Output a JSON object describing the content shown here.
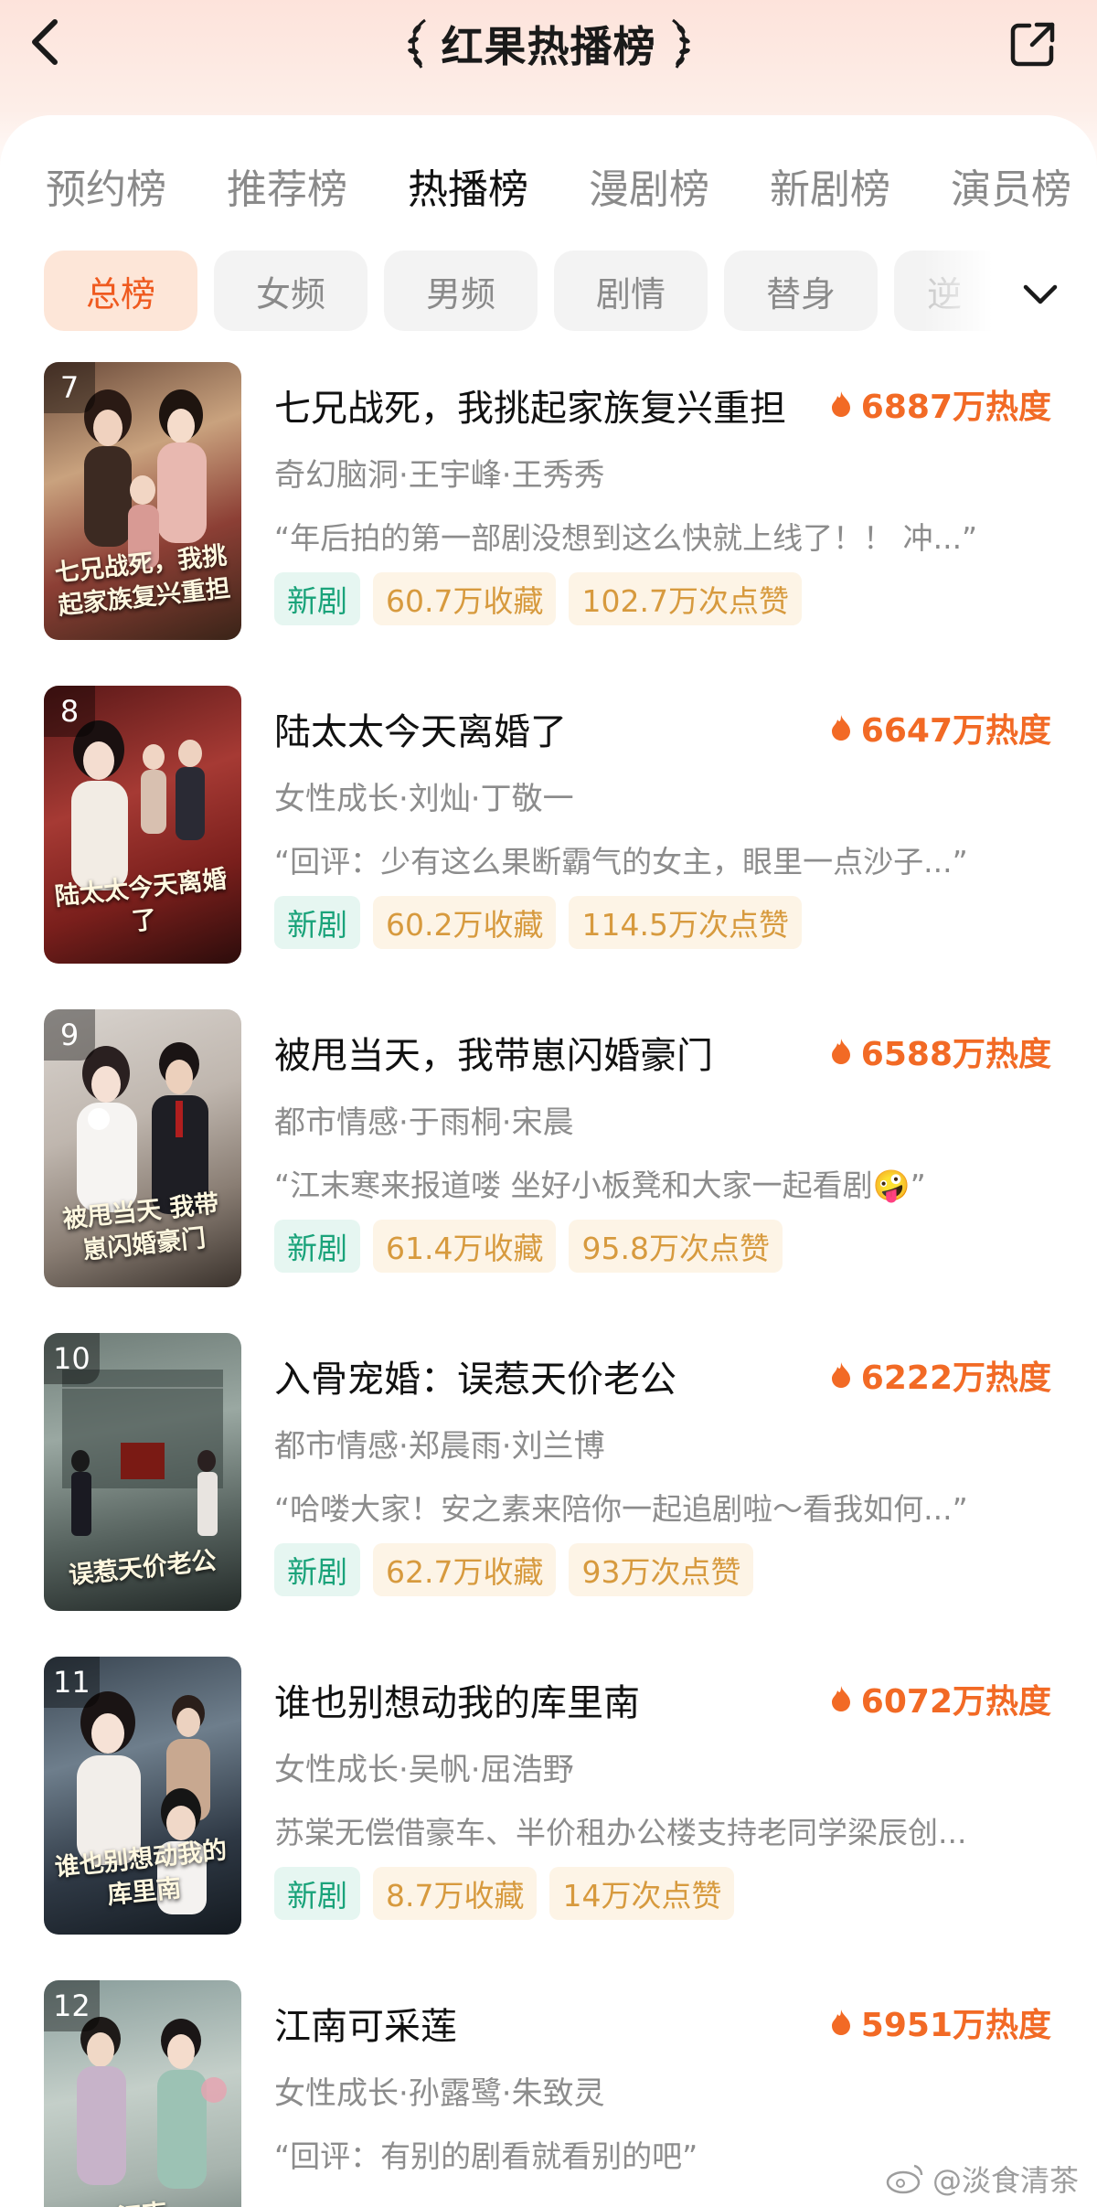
{
  "header": {
    "title": "红果热播榜"
  },
  "tabs": [
    {
      "label": "预约榜"
    },
    {
      "label": "推荐榜"
    },
    {
      "label": "热播榜"
    },
    {
      "label": "漫剧榜"
    },
    {
      "label": "新剧榜"
    },
    {
      "label": "演员榜"
    }
  ],
  "filters": [
    {
      "label": "总榜"
    },
    {
      "label": "女频"
    },
    {
      "label": "男频"
    },
    {
      "label": "剧情"
    },
    {
      "label": "替身"
    },
    {
      "label": "逆"
    }
  ],
  "items": [
    {
      "rank": "7",
      "title": "七兄战死，我挑起家族复兴重担",
      "poster_title": "七兄战死，我挑起家族复兴重担",
      "heat": "6887万热度",
      "meta": "奇幻脑洞·王宇峰·王秀秀",
      "comment": "“年后拍的第一部剧没想到这么快就上线了！！ 冲...”",
      "tag": "新剧",
      "collect": "60.7万收藏",
      "likes": "102.7万次点赞"
    },
    {
      "rank": "8",
      "title": "陆太太今天离婚了",
      "poster_title": "陆太太今天离婚了",
      "heat": "6647万热度",
      "meta": "女性成长·刘灿·丁敬一",
      "comment": "“回评：少有这么果断霸气的女主，眼里一点沙子...”",
      "tag": "新剧",
      "collect": "60.2万收藏",
      "likes": "114.5万次点赞"
    },
    {
      "rank": "9",
      "title": "被甩当天，我带崽闪婚豪门",
      "poster_title": "被甩当天 我带崽闪婚豪门",
      "heat": "6588万热度",
      "meta": "都市情感·于雨桐·宋晨",
      "comment": "“江末寒来报道喽 坐好小板凳和大家一起看剧🤪”",
      "tag": "新剧",
      "collect": "61.4万收藏",
      "likes": "95.8万次点赞"
    },
    {
      "rank": "10",
      "title": "入骨宠婚：误惹天价老公",
      "poster_title": "误惹天价老公",
      "heat": "6222万热度",
      "meta": "都市情感·郑晨雨·刘兰博",
      "comment": "“哈喽大家！安之素来陪你一起追剧啦～看我如何...”",
      "tag": "新剧",
      "collect": "62.7万收藏",
      "likes": "93万次点赞"
    },
    {
      "rank": "11",
      "title": "谁也别想动我的库里南",
      "poster_title": "谁也别想动我的库里南",
      "heat": "6072万热度",
      "meta": "女性成长·吴帆·屈浩野",
      "comment": "苏棠无偿借豪车、半价租办公楼支持老同学梁辰创...",
      "tag": "新剧",
      "collect": "8.7万收藏",
      "likes": "14万次点赞"
    },
    {
      "rank": "12",
      "title": "江南可采莲",
      "poster_title": "江南",
      "heat": "5951万热度",
      "meta": "女性成长·孙露鹭·朱致灵",
      "comment": "“回评：有别的剧看就看别的吧”",
      "tag": "",
      "collect": "",
      "likes": ""
    }
  ],
  "watermark": "@淡食清茶",
  "colors": {
    "accent": "#f26a25",
    "new_tag": "#1aa37a",
    "stat_tag": "#d79a3e"
  }
}
